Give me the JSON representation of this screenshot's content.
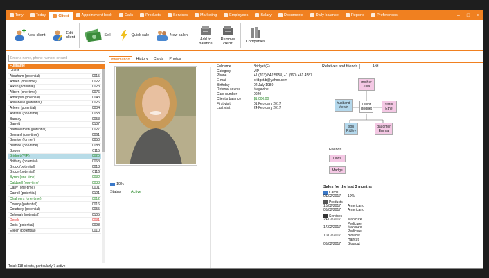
{
  "tabs": [
    {
      "label": "Tony",
      "active": false
    },
    {
      "label": "Today",
      "active": false
    },
    {
      "label": "Client",
      "active": true
    },
    {
      "label": "Appointment book",
      "active": false
    },
    {
      "label": "Calls",
      "active": false
    },
    {
      "label": "Products",
      "active": false
    },
    {
      "label": "Services",
      "active": false
    },
    {
      "label": "Marketing",
      "active": false
    },
    {
      "label": "Employees",
      "active": false
    },
    {
      "label": "Salary",
      "active": false
    },
    {
      "label": "Documents",
      "active": false
    },
    {
      "label": "Daily balance",
      "active": false
    },
    {
      "label": "Reports",
      "active": false
    },
    {
      "label": "Preferences",
      "active": false
    }
  ],
  "ribbon": {
    "new_client": "New client",
    "edit_client": "Edit client",
    "sell": "Sell",
    "quick_sale": "Quick sale",
    "new_salon": "New salon",
    "add_to_balance": "Add to balance",
    "remove_credit": "Remove credit",
    "companies": "Companies"
  },
  "search": {
    "placeholder": "Enter a name, phone number or card"
  },
  "list": {
    "header": "Fullname",
    "rows": [
      {
        "name": "Guest",
        "num": "",
        "style": "normal"
      },
      {
        "name": "Abraham (potential)",
        "num": "0015",
        "style": "normal"
      },
      {
        "name": "Adrien (one-time)",
        "num": "0022",
        "style": "normal"
      },
      {
        "name": "Aiken (potential)",
        "num": "0023",
        "style": "normal"
      },
      {
        "name": "Albern (one-time)",
        "num": "0076",
        "style": "normal"
      },
      {
        "name": "Amaryllis (potential)",
        "num": "0043",
        "style": "normal"
      },
      {
        "name": "Annabelle (potential)",
        "num": "0026",
        "style": "normal"
      },
      {
        "name": "Arleen (potential)",
        "num": "0004",
        "style": "normal"
      },
      {
        "name": "Atwater (one-time)",
        "num": "0058",
        "style": "normal"
      },
      {
        "name": "Barclay",
        "num": "0053",
        "style": "normal"
      },
      {
        "name": "Barrett",
        "num": "0107",
        "style": "normal"
      },
      {
        "name": "Bartholemew (potential)",
        "num": "0027",
        "style": "normal"
      },
      {
        "name": "Bernard (one-time)",
        "num": "0061",
        "style": "normal"
      },
      {
        "name": "Bernice (former)",
        "num": "0050",
        "style": "normal"
      },
      {
        "name": "Bernice (one-time)",
        "num": "0088",
        "style": "normal"
      },
      {
        "name": "Bowen",
        "num": "0115",
        "style": "normal"
      },
      {
        "name": "Bridget (VIP)",
        "num": "0020",
        "style": "selected"
      },
      {
        "name": "Brittany (potential)",
        "num": "0063",
        "style": "normal"
      },
      {
        "name": "Brock (potential)",
        "num": "0013",
        "style": "normal"
      },
      {
        "name": "Bruce (potential)",
        "num": "0116",
        "style": "normal"
      },
      {
        "name": "Byron (one-time)",
        "num": "0032",
        "style": "green"
      },
      {
        "name": "Caldwell (one-time)",
        "num": "0038",
        "style": "green"
      },
      {
        "name": "Carly (one-time)",
        "num": "0001",
        "style": "normal"
      },
      {
        "name": "Carroll (potential)",
        "num": "0101",
        "style": "normal"
      },
      {
        "name": "Chalmers (one-time)",
        "num": "0012",
        "style": "green"
      },
      {
        "name": "Conroy (potential)",
        "num": "0016",
        "style": "normal"
      },
      {
        "name": "Courtney (potential)",
        "num": "0055",
        "style": "normal"
      },
      {
        "name": "Deborah (potential)",
        "num": "0105",
        "style": "normal"
      },
      {
        "name": "Derek",
        "num": "0031",
        "style": "red"
      },
      {
        "name": "Doris (potential)",
        "num": "0098",
        "style": "normal"
      },
      {
        "name": "Eileen (potential)",
        "num": "0010",
        "style": "normal"
      }
    ],
    "total": "Total: 118 clients, particularly 7 active."
  },
  "detail_tabs": [
    "Information",
    "History",
    "Cards",
    "Photos"
  ],
  "discount": "10%",
  "status": {
    "label": "Status",
    "value": "Active"
  },
  "info": [
    {
      "key": "Fullname",
      "value": "Bridget (F)",
      "style": "normal"
    },
    {
      "key": "Category",
      "value": "VIP",
      "style": "normal"
    },
    {
      "key": "Phone",
      "value": "+1 (703) 842 5658, +1 (360) 461 4587",
      "style": "normal"
    },
    {
      "key": "E-mail",
      "value": "bridget.b@yahoo.com",
      "style": "normal"
    },
    {
      "key": "Birthday",
      "value": "02 July 1980",
      "style": "normal"
    },
    {
      "key": "Referral source",
      "value": "Magazine",
      "style": "normal"
    },
    {
      "key": "Card number",
      "value": "0020",
      "style": "normal"
    },
    {
      "key": "Client's balance",
      "value": "$1,000.00",
      "style": "green"
    },
    {
      "key": "First visit",
      "value": "01 February 2017",
      "style": "normal"
    },
    {
      "key": "Last visit",
      "value": "24 February 2017",
      "style": "normal"
    }
  ],
  "relatives": {
    "label": "Relatives and friends",
    "add_label": "Add",
    "mother": [
      "mother",
      "Julia"
    ],
    "husband": [
      "husband",
      "Melvin"
    ],
    "client": [
      "Client",
      "Bridget"
    ],
    "sister": [
      "sister",
      "Ethel"
    ],
    "son": [
      "son",
      "Ridley"
    ],
    "daughter": [
      "daughter",
      "Emma"
    ]
  },
  "friends": {
    "label": "Friends",
    "items": [
      "Doris",
      "Madge"
    ]
  },
  "sales": {
    "title": "Sales for the last 3 months",
    "categories": [
      {
        "name": "Cards",
        "icon": "card-icon",
        "rows": [
          {
            "date": "01/02/2017",
            "item": "10%"
          }
        ]
      },
      {
        "name": "Products",
        "icon": "product-icon",
        "rows": [
          {
            "date": "10/02/2017",
            "item": "Americano"
          },
          {
            "date": "03/02/2017",
            "item": "Americano"
          }
        ]
      },
      {
        "name": "Services",
        "icon": "service-icon",
        "rows": [
          {
            "date": "24/02/2017",
            "item": "Manicure"
          },
          {
            "date": "",
            "item": "Pedicure"
          },
          {
            "date": "17/02/2017",
            "item": "Manicure"
          },
          {
            "date": "",
            "item": "Pedicure"
          },
          {
            "date": "10/02/2017",
            "item": "Blowout"
          },
          {
            "date": "",
            "item": "Haircut"
          },
          {
            "date": "03/02/2017",
            "item": "Blowout"
          }
        ]
      }
    ]
  },
  "colors": {
    "accent": "#f08020",
    "selected_row": "#b8dce8",
    "active_green": "#2a8a2a",
    "red": "#e03030",
    "pink_node": "#f4c8e4",
    "blue_node": "#b4d8ec"
  }
}
